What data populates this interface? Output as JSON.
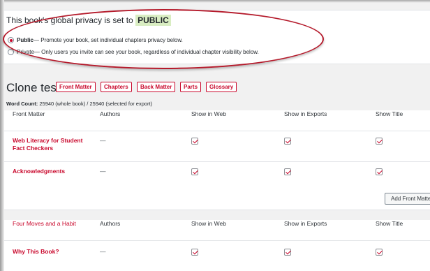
{
  "privacy": {
    "title_prefix": "This book's global privacy is set to",
    "status": "PUBLIC",
    "public_label": "Public",
    "public_desc": " — Promote your book, set individual chapters privacy below.",
    "private_label": "Private",
    "private_desc": " — Only users you invite can see your book, regardless of individual chapter visibility below."
  },
  "book": {
    "title": "Clone test",
    "tabs": [
      "Front Matter",
      "Chapters",
      "Back Matter",
      "Parts",
      "Glossary"
    ],
    "word_count_label": "Word Count:",
    "word_count_value": " 25940 (whole book) / 25940 (selected for export)"
  },
  "front_matter_table": {
    "headers": [
      "Front Matter",
      "Authors",
      "Show in Web",
      "Show in Exports",
      "Show Title"
    ],
    "rows": [
      {
        "title": "Web Literacy for Student Fact Checkers",
        "authors": "—"
      },
      {
        "title": "Acknowledgments",
        "authors": "—"
      }
    ],
    "add_button": "Add Front Matter"
  },
  "part_table": {
    "headers": [
      "Four Moves and a Habit",
      "Authors",
      "Show in Web",
      "Show in Exports",
      "Show Title"
    ],
    "rows": [
      {
        "title": "Why This Book?",
        "authors": "—"
      }
    ]
  },
  "colors": {
    "accent": "#c9082c",
    "badge_bg": "#d9edc2",
    "annotation": "#b51a2b"
  }
}
